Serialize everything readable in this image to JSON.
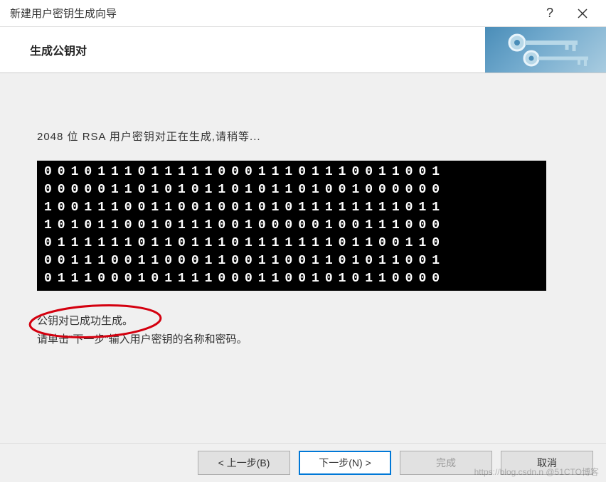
{
  "window": {
    "title": "新建用户密钥生成向导",
    "help": "?",
    "close": "×"
  },
  "banner": {
    "title": "生成公钥对"
  },
  "content": {
    "generating_label": "2048 位 RSA 用户密钥对正在生成,请稍等...",
    "bits": "001011101111100011101110011001\n000001101010110101101001000000\n100111001100100101011111111011\n101011001011100100000100111000\n011111101101110111111101100110\n001110011000110011001101011001\n011100010111100011001010110000",
    "status_done": "公钥对已成功生成。",
    "status_hint": "请单击\"下一步\"输入用户密钥的名称和密码。"
  },
  "footer": {
    "back": "< 上一步(B)",
    "next": "下一步(N) >",
    "finish": "完成",
    "cancel": "取消"
  },
  "watermark": "https://blog.csdn.n @51CTO博客"
}
